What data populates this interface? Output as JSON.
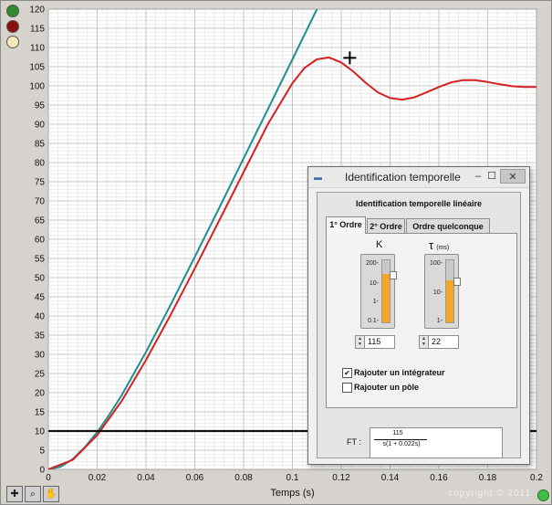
{
  "leds": {
    "led1_color": "#2e8b2e",
    "led2_color": "#8b0f0f",
    "led3_color": "#f5e9b8"
  },
  "chart_data": {
    "type": "line",
    "xlabel": "Temps (s)",
    "ylabel": "",
    "xlim": [
      0,
      0.2
    ],
    "ylim": [
      0,
      120
    ],
    "x_ticks": [
      "0",
      "0.02",
      "0.04",
      "0.06",
      "0.08",
      "0.1",
      "0.12",
      "0.14",
      "0.16",
      "0.18",
      "0.2"
    ],
    "y_ticks": [
      "0",
      "5",
      "10",
      "15",
      "20",
      "25",
      "30",
      "35",
      "40",
      "45",
      "50",
      "55",
      "60",
      "65",
      "70",
      "75",
      "80",
      "85",
      "90",
      "95",
      "100",
      "105",
      "110",
      "115",
      "120"
    ],
    "grid": true,
    "series": [
      {
        "color": "#1e8f8f",
        "x": [
          0,
          0.005,
          0.01,
          0.015,
          0.02,
          0.025,
          0.03,
          0.04,
          0.05,
          0.06,
          0.07,
          0.08,
          0.09,
          0.1,
          0.11,
          0.12,
          0.126
        ],
        "y": [
          0,
          0.7,
          2.7,
          5.8,
          9.7,
          14.3,
          19.3,
          30.6,
          42.8,
          55.4,
          68.2,
          81.1,
          94.0,
          106.9,
          119.9,
          132.8,
          140.6
        ]
      },
      {
        "color": "#d61f1f",
        "x": [
          0,
          0.01,
          0.02,
          0.03,
          0.04,
          0.05,
          0.06,
          0.07,
          0.08,
          0.09,
          0.1,
          0.105,
          0.11,
          0.115,
          0.12,
          0.125,
          0.13,
          0.135,
          0.14,
          0.145,
          0.15,
          0.155,
          0.16,
          0.165,
          0.17,
          0.175,
          0.18,
          0.185,
          0.19,
          0.195,
          0.2
        ],
        "y": [
          0,
          2.5,
          8.9,
          17.8,
          28.5,
          40.2,
          52.4,
          64.9,
          77.5,
          90.1,
          100.7,
          104.7,
          106.9,
          107.4,
          106.1,
          103.7,
          100.8,
          98.3,
          96.8,
          96.4,
          97.0,
          98.3,
          99.7,
          100.9,
          101.5,
          101.5,
          101.0,
          100.4,
          99.9,
          99.7,
          99.7
        ]
      },
      {
        "color": "#111111",
        "x": [
          0,
          0.2
        ],
        "y": [
          10,
          10
        ]
      }
    ]
  },
  "copyright": "copyright © 2011",
  "dialog": {
    "title": "Identification temporelle",
    "minimize_glyph": "–",
    "maximize_glyph": "☐",
    "close_glyph": "✕",
    "panel_title": "Identification temporelle linéaire",
    "tabs": [
      "1° Ordre",
      "2° Ordre",
      "Ordre quelconque"
    ],
    "k_label": "K",
    "tau_label": "τ",
    "tau_unit": "(ms)",
    "k_ticks": [
      "200-",
      "10-",
      "1-",
      "0.1-"
    ],
    "tau_ticks": [
      "100-",
      "10-",
      "1-"
    ],
    "k_level": 0.78,
    "tau_level": 0.67,
    "k_value": "115",
    "tau_value": "22",
    "integrator_label": "Rajouter un intégrateur",
    "integrator_checked": true,
    "pole_label": "Rajouter un pôle",
    "pole_checked": false,
    "ft_label": "FT :",
    "ft_numerator": "115",
    "ft_denominator": "s(1 + 0.022s)"
  }
}
